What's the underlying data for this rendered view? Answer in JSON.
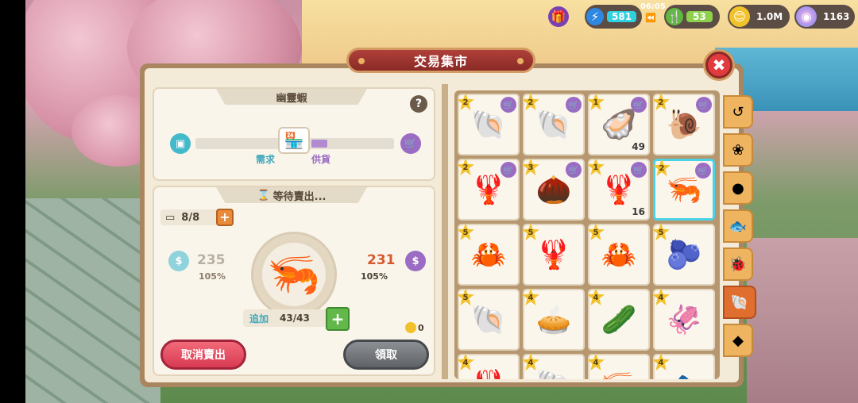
{
  "hud": {
    "time": "06:05",
    "energy": "581",
    "stamina": "53",
    "coins": "1.0M",
    "gems": "1163"
  },
  "panel": {
    "title": "交易集市",
    "close_icon": "close-icon"
  },
  "item_info": {
    "name": "幽靈蝦",
    "help": "?",
    "demand_label": "需求",
    "supply_label": "供貨",
    "supply_fraction": 0.08
  },
  "sale": {
    "status": "等待賣出...",
    "slots": "8/8",
    "sell_price_left": "235",
    "sell_pct_left": "105%",
    "sell_price_right": "231",
    "sell_pct_right": "105%",
    "add_label": "追加",
    "add_count": "43/43",
    "earned": "0",
    "cancel_button": "取消賣出",
    "collect_button": "領取"
  },
  "grid_items": [
    {
      "icon": "🐚",
      "star": "2",
      "count": ""
    },
    {
      "icon": "🐚",
      "star": "2",
      "count": ""
    },
    {
      "icon": "🦪",
      "star": "1",
      "count": "49"
    },
    {
      "icon": "🐌",
      "star": "2",
      "count": ""
    },
    {
      "icon": "🦞",
      "star": "2",
      "count": ""
    },
    {
      "icon": "🌰",
      "star": "3",
      "count": ""
    },
    {
      "icon": "🦞",
      "star": "1",
      "count": "16"
    },
    {
      "icon": "🦐",
      "star": "2",
      "count": "",
      "selected": true
    },
    {
      "icon": "🦀",
      "star": "5",
      "count": ""
    },
    {
      "icon": "🦞",
      "star": "5",
      "count": ""
    },
    {
      "icon": "🦀",
      "star": "5",
      "count": ""
    },
    {
      "icon": "🫐",
      "star": "5",
      "count": ""
    },
    {
      "icon": "🐚",
      "star": "5",
      "count": ""
    },
    {
      "icon": "🥧",
      "star": "4",
      "count": ""
    },
    {
      "icon": "🥒",
      "star": "4",
      "count": ""
    },
    {
      "icon": "🦑",
      "star": "4",
      "count": ""
    },
    {
      "icon": "🦞",
      "star": "4",
      "count": ""
    },
    {
      "icon": "🐚",
      "star": "4",
      "count": ""
    },
    {
      "icon": "🦐",
      "star": "4",
      "count": ""
    },
    {
      "icon": "🐟",
      "star": "4",
      "count": ""
    }
  ],
  "side_tabs": [
    "history-icon",
    "crop-icon",
    "fruit-icon",
    "fish-icon",
    "bug-icon",
    "shell-icon",
    "mineral-icon"
  ]
}
